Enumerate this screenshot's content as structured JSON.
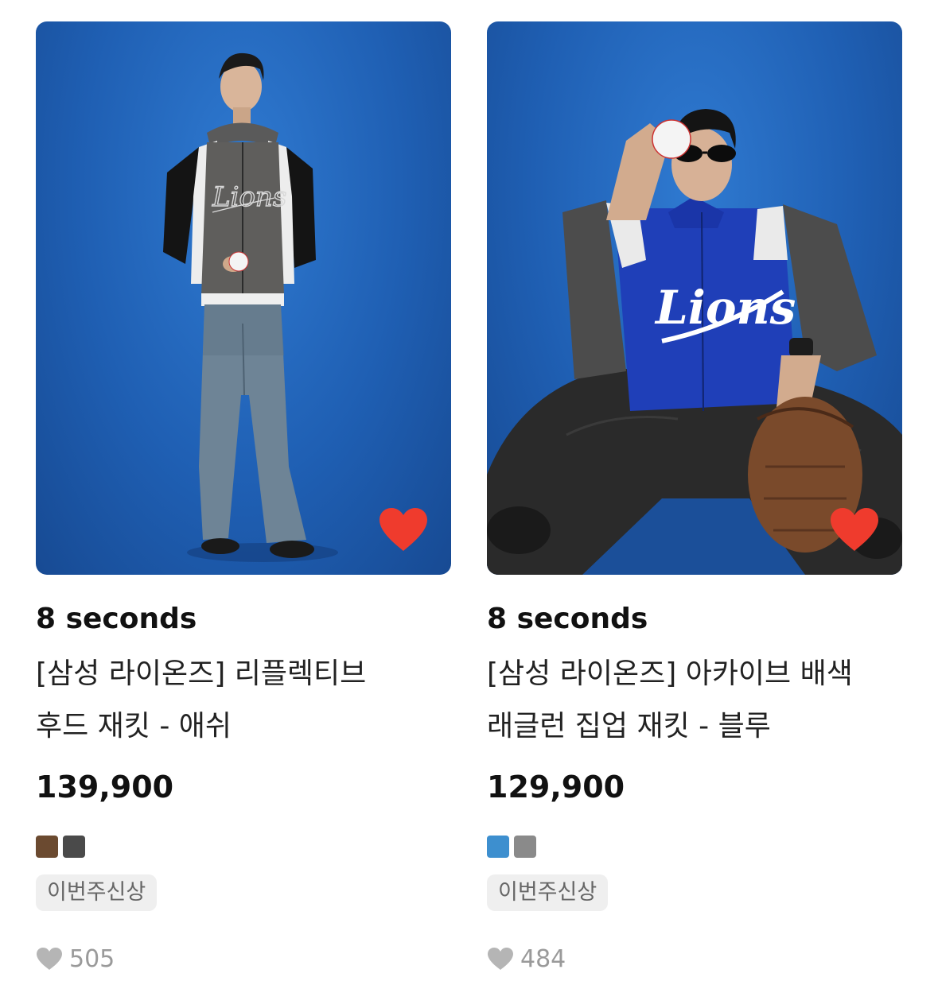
{
  "products": [
    {
      "brand": "8 seconds",
      "title": "[삼성 라이온즈] 리플렉티브 후드 재킷 - 애쉬",
      "price": "139,900",
      "swatch_colors": [
        "#6b4a30",
        "#4a4a4a"
      ],
      "tag": "이번주신상",
      "like_count": "505",
      "wishlisted": true,
      "jacket_lettering": "Lions"
    },
    {
      "brand": "8 seconds",
      "title": "[삼성 라이온즈] 아카이브 배색 래글런 집업 재킷 - 블루",
      "price": "129,900",
      "swatch_colors": [
        "#3d8fcf",
        "#8a8a8a"
      ],
      "tag": "이번주신상",
      "like_count": "484",
      "wishlisted": true,
      "jacket_lettering": "Lions"
    }
  ],
  "colors": {
    "heart_active": "#ef3b2d",
    "heart_inactive": "#b5b5b5",
    "photo_background": "#1f5fb3"
  }
}
